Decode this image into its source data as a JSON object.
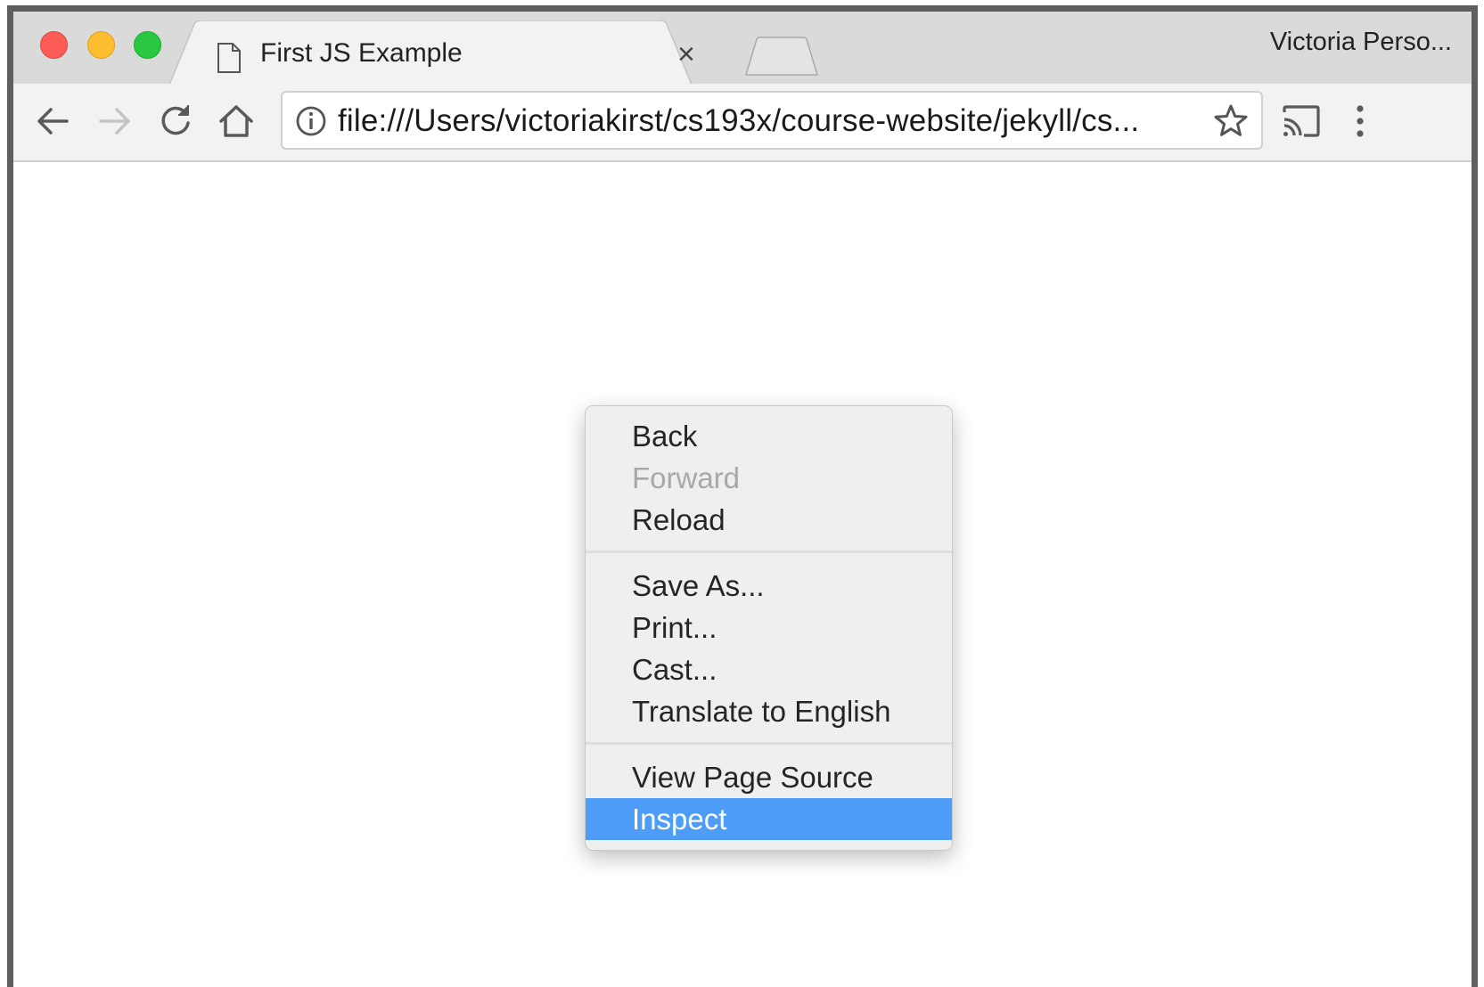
{
  "window": {
    "traffic_lights": [
      "close",
      "minimize",
      "maximize"
    ]
  },
  "tab": {
    "title": "First JS Example",
    "close_glyph": "×",
    "icon": "document-icon"
  },
  "profile": {
    "name": "Victoria Perso..."
  },
  "toolbar": {
    "url": "file:///Users/victoriakirst/cs193x/course-website/jekyll/cs...",
    "icons": [
      "back-arrow-icon",
      "forward-arrow-icon",
      "reload-icon",
      "home-icon",
      "info-icon",
      "star-icon",
      "cast-icon",
      "more-vert-icon"
    ]
  },
  "context_menu": {
    "groups": [
      [
        {
          "label": "Back",
          "state": "enabled"
        },
        {
          "label": "Forward",
          "state": "disabled"
        },
        {
          "label": "Reload",
          "state": "enabled"
        }
      ],
      [
        {
          "label": "Save As...",
          "state": "enabled"
        },
        {
          "label": "Print...",
          "state": "enabled"
        },
        {
          "label": "Cast...",
          "state": "enabled"
        },
        {
          "label": "Translate to English",
          "state": "enabled"
        }
      ],
      [
        {
          "label": "View Page Source",
          "state": "enabled"
        },
        {
          "label": "Inspect",
          "state": "highlighted"
        }
      ]
    ]
  },
  "colors": {
    "highlight": "#4d9cf8",
    "titlebar": "#dadada",
    "toolbar": "#f2f2f2"
  }
}
